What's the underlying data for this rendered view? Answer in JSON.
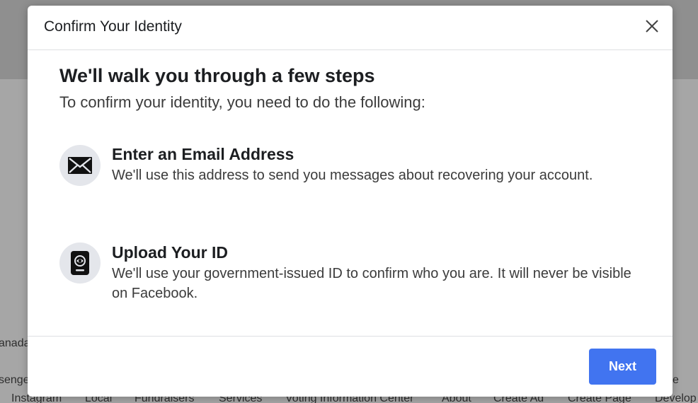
{
  "background": {
    "footer_row1": [
      "anada",
      "senge",
      "e"
    ],
    "footer_links": [
      "Instagram",
      "Local",
      "Fundraisers",
      "Services",
      "Voting Information Center",
      "About",
      "Create Ad",
      "Create Page",
      "Develop"
    ]
  },
  "dialog": {
    "title": "Confirm Your Identity",
    "close_icon": "close-icon",
    "headline": "We'll walk you through a few steps",
    "subheadline": "To confirm your identity, you need to do the following:",
    "steps": [
      {
        "icon": "envelope-icon",
        "title": "Enter an Email Address",
        "description": "We'll use this address to send you messages about recovering your account."
      },
      {
        "icon": "id-card-icon",
        "title": "Upload Your ID",
        "description": "We'll use your government-issued ID to confirm who you are. It will never be visible on Facebook."
      }
    ],
    "next_label": "Next"
  },
  "colors": {
    "accent": "#4174f0",
    "icon_bg": "#e4e6eb"
  }
}
